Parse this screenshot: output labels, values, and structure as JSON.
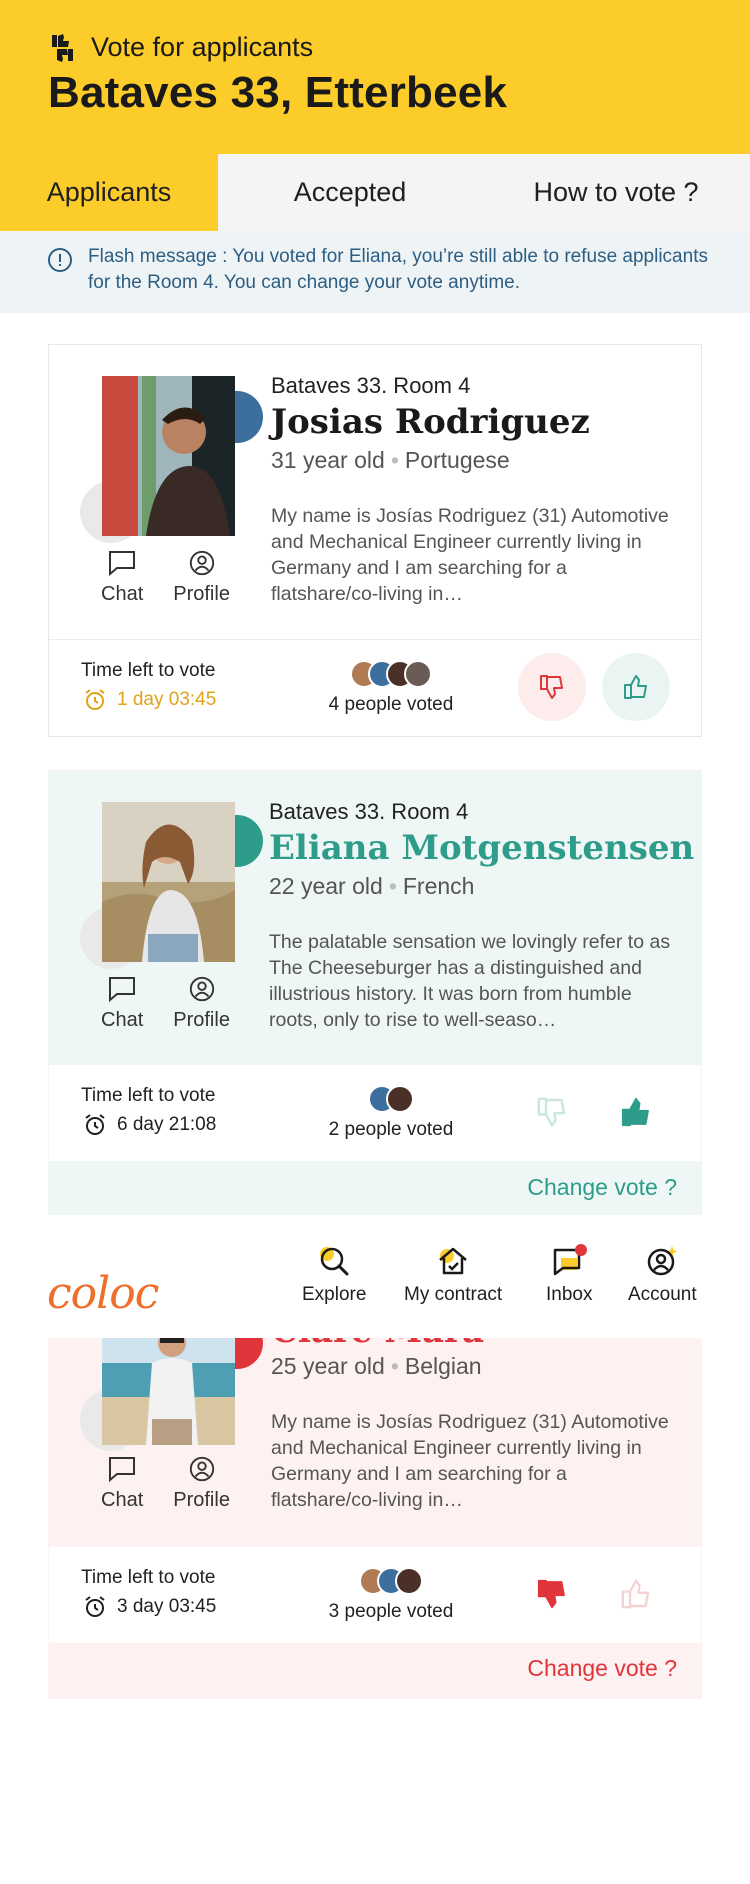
{
  "header": {
    "subtitle": "Vote for applicants",
    "title": "Bataves 33, Etterbeek"
  },
  "tabs": [
    {
      "label": "Applicants",
      "active": true
    },
    {
      "label": "Accepted",
      "active": false
    },
    {
      "label": "How to vote ?",
      "active": false
    }
  ],
  "flash": {
    "text": "Flash message : You voted for Eliana, you’re still able to refuse applicants for the Room 4. You can change your vote anytime."
  },
  "cards": [
    {
      "room": "Bataves 33. Room 4",
      "name": "Josias Rodriguez",
      "age": "31 year old",
      "nationality": "Portugese",
      "bio": "My name is Josías Rodriguez (31) Automotive and Mechanical Engineer currently living in Germany and I am searching for a flatshare/co-living in…",
      "chat_label": "Chat",
      "profile_label": "Profile",
      "time_label": "Time left to vote",
      "time_value": "1 day 03:45",
      "voted_label": "4 people voted",
      "name_color": "#1a1a1a",
      "accent": "#3C6E9E"
    },
    {
      "room": "Bataves 33. Room 4",
      "name": "Eliana Motgenstensen",
      "age": "22 year old",
      "nationality": "French",
      "bio": "The palatable sensation we lovingly refer to as The Cheeseburger has a distinguished and illustrious history. It was born from humble roots, only to rise to well-seaso…",
      "chat_label": "Chat",
      "profile_label": "Profile",
      "time_label": "Time left to vote",
      "time_value": "6 day 21:08",
      "voted_label": "2 people voted",
      "change_label": "Change vote ?",
      "name_color": "#2E9C8A",
      "accent": "#2E9C8A"
    },
    {
      "name": "Clare Mara",
      "age": "25 year old",
      "nationality": "Belgian",
      "bio": "My name is Josías Rodriguez (31) Automotive and Mechanical Engineer currently living in Germany and I am searching for a flatshare/co-living in…",
      "chat_label": "Chat",
      "profile_label": "Profile",
      "time_label": "Time left to vote",
      "time_value": "3 day 03:45",
      "voted_label": "3 people voted",
      "change_label": "Change vote ?",
      "name_color": "#E0353B",
      "accent": "#E0353B"
    }
  ],
  "nav": {
    "logo": "coloc",
    "items": [
      {
        "label": "Explore",
        "icon": "search-icon"
      },
      {
        "label": "My contract",
        "icon": "house-icon"
      },
      {
        "label": "Inbox",
        "icon": "chat-icon"
      },
      {
        "label": "Account",
        "icon": "user-circle-icon"
      }
    ]
  },
  "colors": {
    "brand_yellow": "#FCCD2A",
    "teal": "#2E9C8A",
    "red": "#E0353B",
    "link_blue": "#2D5E82",
    "warning_orange": "#E0A316"
  }
}
